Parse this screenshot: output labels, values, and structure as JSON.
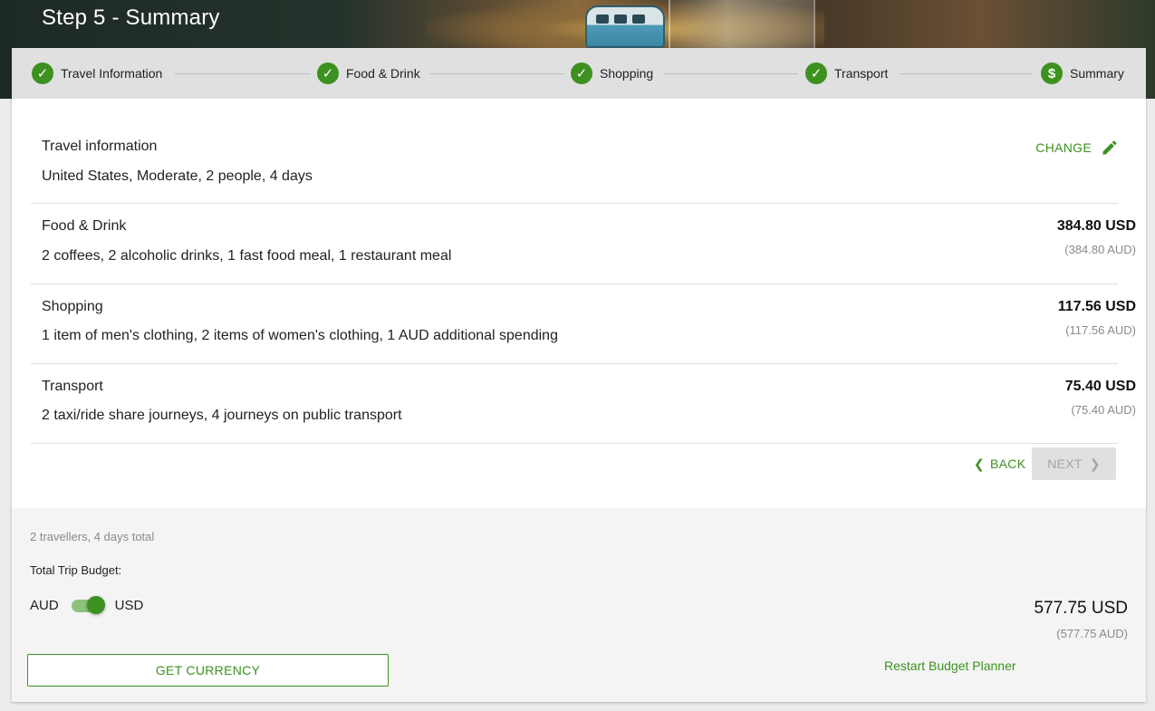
{
  "header": {
    "title": "Step 5 - Summary"
  },
  "stepper": {
    "steps": [
      {
        "label": "Travel Information",
        "icon": "check-icon",
        "state": "complete"
      },
      {
        "label": "Food & Drink",
        "icon": "check-icon",
        "state": "complete"
      },
      {
        "label": "Shopping",
        "icon": "check-icon",
        "state": "complete"
      },
      {
        "label": "Transport",
        "icon": "check-icon",
        "state": "complete"
      },
      {
        "label": "Summary",
        "icon": "dollar-icon",
        "state": "active"
      }
    ]
  },
  "summary": {
    "travel": {
      "title": "Travel information",
      "desc": "United States, Moderate, 2 people, 4 days",
      "change_label": "CHANGE"
    },
    "food": {
      "title": "Food & Drink",
      "desc": "2 coffees, 2 alcoholic drinks, 1 fast food meal, 1 restaurant meal",
      "amount": "384.80 USD",
      "amount_sub": "(384.80 AUD)"
    },
    "shopping": {
      "title": "Shopping",
      "desc": "1 item of men's clothing, 2 items of women's clothing, 1 AUD additional spending",
      "amount": "117.56 USD",
      "amount_sub": "(117.56 AUD)"
    },
    "transport": {
      "title": "Transport",
      "desc": "2 taxi/ride share journeys, 4 journeys on public transport",
      "amount": "75.40 USD",
      "amount_sub": "(75.40 AUD)"
    }
  },
  "nav": {
    "back_label": "BACK",
    "next_label": "NEXT"
  },
  "footer": {
    "travellers": "2 travellers, 4 days total",
    "total_label": "Total Trip Budget:",
    "toggle_left": "AUD",
    "toggle_right": "USD",
    "toggle_selected": "USD",
    "total": "577.75 USD",
    "total_sub": "(577.75 AUD)",
    "currency_button": "GET CURRENCY",
    "restart_link": "Restart Budget Planner"
  },
  "colors": {
    "accent": "#3d9120",
    "stepper_bg": "#e0e0e0",
    "footer_bg": "#f4f4f4"
  }
}
